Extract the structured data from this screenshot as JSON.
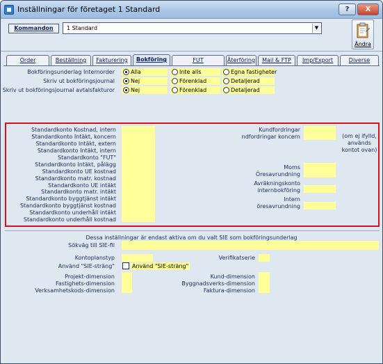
{
  "window": {
    "title": "Inställningar för företaget 1 Standard",
    "help_label": "?",
    "close_label": "X"
  },
  "command": {
    "button_label": "Kommandon",
    "value": "1 Standard",
    "dropdown_arrow": "▼"
  },
  "edit_button": {
    "label": "Ändra",
    "icon": "clipboard-edit-icon"
  },
  "tabs": [
    {
      "label": "Order"
    },
    {
      "label": "Beställning"
    },
    {
      "label": "Fakturering"
    },
    {
      "label": "Bokföring"
    },
    {
      "label": "FUT"
    },
    {
      "label": "Återföring"
    },
    {
      "label": "Mail & FTP"
    },
    {
      "label": "Imp/Export"
    },
    {
      "label": "Diverse"
    }
  ],
  "active_tab": "Bokföring",
  "settings": {
    "row1": {
      "label": "Bokföringsunderlag Internorder",
      "options": [
        "Alla",
        "Inte alls",
        "Egna fastigheter"
      ],
      "selected": 0
    },
    "row2": {
      "label": "Skriv ut bokföringsjournal",
      "options": [
        "Nej",
        "Förenklad",
        "Detaljerad"
      ],
      "selected": 0
    },
    "row3": {
      "label": "Skriv ut bokföringsjournal avtalsfakturor",
      "options": [
        "Nej",
        "Förenklad",
        "Detaljerad"
      ],
      "selected": 0
    }
  },
  "accounts": {
    "left_labels": [
      "Standardkonto Kostnad, intern",
      "Standardkonto Intäkt, koncern",
      "Standardkonto Intäkt, extern",
      "Standardkonto Intäkt, intern",
      "Standardkonto \"FUT\"",
      "Standardkonto Intäkt, pålägg",
      "Standardkonto UE kostnad",
      "Standardkonto matr. kostnad",
      "Standardkonto UE intäkt",
      "Standardkonto matr. intäkt",
      "Standardkonto byggtjänst intäkt",
      "Standardkonto byggtjänst kostnad",
      "Standardkonto underhåll intäkt",
      "Standardkonto underhåll kostnad"
    ],
    "kundfordringar": "Kundfordringar",
    "kundfordringar_koncern": "ndfordringar koncern",
    "note": "(om ej ifylld, används kontot ovan)",
    "moms": "Moms",
    "oresavrundning": "Öresavrundning",
    "avrakningskonto": "Avräkningskonto",
    "internbokforing": "internbokföring",
    "intern": "Intern",
    "oresavrundning_intern": "öresavrundning"
  },
  "sie": {
    "note": "Dessa inställningar är endast aktiva om du valt SIE som bokföringsunderlag",
    "path_label": "Sökväg till SIE-fil",
    "kontoplanstyp": "Kontoplanstyp",
    "verifikatserie": "Verifikatserie",
    "use_string_label": "Använd \"SIE-sträng\"",
    "use_string_checkbox": "Använd \"SIE-sträng\"",
    "projekt": "Projekt-dimension",
    "fastighet": "Fastighets-dimension",
    "verksamhet": "Verksamhetskods-dimension",
    "kund": "Kund-dimension",
    "byggnad": "Byggnadsverks-dimension",
    "faktura": "Faktura-dimension"
  },
  "colors": {
    "field": "#ffff99",
    "highlight": "#d8101a",
    "window": "#dfe7f1"
  }
}
